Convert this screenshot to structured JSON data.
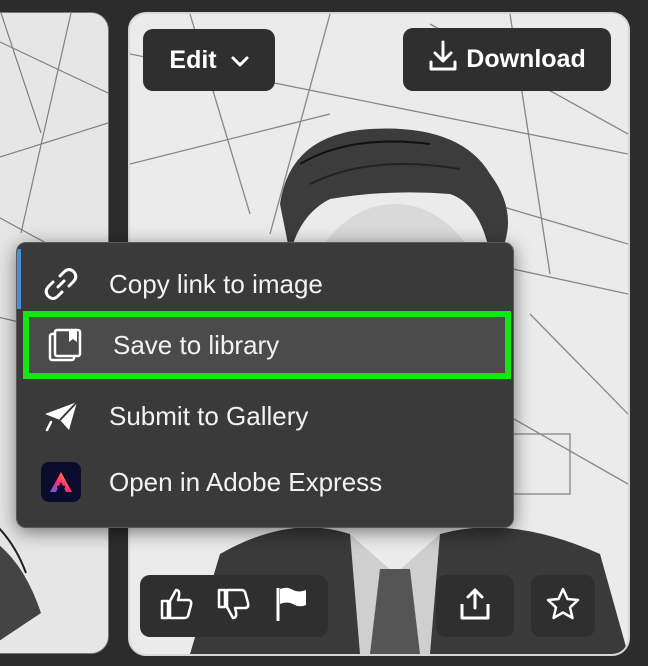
{
  "toolbar": {
    "edit_label": "Edit",
    "download_label": "Download"
  },
  "context_menu": {
    "items": [
      {
        "label": "Copy link to image",
        "icon": "link-icon"
      },
      {
        "label": "Save to library",
        "icon": "library-icon",
        "highlighted": true
      },
      {
        "label": "Submit to Gallery",
        "icon": "paper-plane-icon"
      },
      {
        "label": "Open in Adobe Express",
        "icon": "adobe-express-icon"
      }
    ]
  },
  "actions": {
    "like_icon": "thumbs-up-icon",
    "dislike_icon": "thumbs-down-icon",
    "report_icon": "flag-icon",
    "share_icon": "share-icon",
    "favorite_icon": "star-icon"
  },
  "colors": {
    "highlight_border": "#14e614",
    "menu_background": "#3a3a3a",
    "accent": "#4a90d9"
  }
}
